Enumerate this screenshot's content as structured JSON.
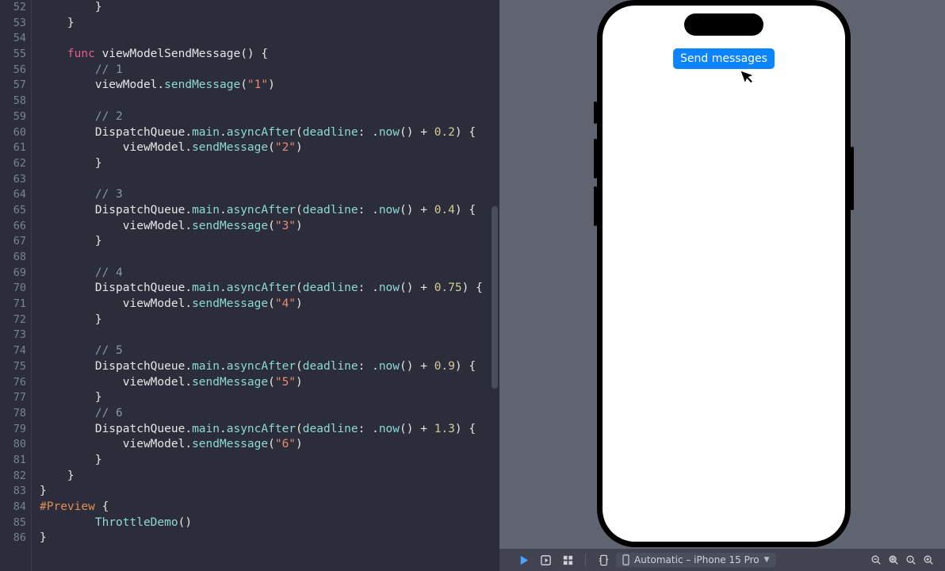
{
  "editor": {
    "line_start": 52,
    "lines": [
      {
        "n": 52,
        "indent": 4,
        "tokens": [
          {
            "t": "}",
            "c": "punct"
          }
        ]
      },
      {
        "n": 53,
        "indent": 2,
        "tokens": [
          {
            "t": "}",
            "c": "punct"
          }
        ]
      },
      {
        "n": 54,
        "indent": 0,
        "tokens": []
      },
      {
        "n": 55,
        "indent": 2,
        "tokens": [
          {
            "t": "func ",
            "c": "kw"
          },
          {
            "t": "viewModelSendMessage",
            "c": "fn"
          },
          {
            "t": "() {",
            "c": "punct"
          }
        ]
      },
      {
        "n": 56,
        "indent": 4,
        "tokens": [
          {
            "t": "// 1",
            "c": "cmt"
          }
        ]
      },
      {
        "n": 57,
        "indent": 4,
        "tokens": [
          {
            "t": "viewModel",
            "c": "fn"
          },
          {
            "t": ".",
            "c": "punct"
          },
          {
            "t": "sendMessage",
            "c": "call"
          },
          {
            "t": "(",
            "c": "punct"
          },
          {
            "t": "\"1\"",
            "c": "str"
          },
          {
            "t": ")",
            "c": "punct"
          }
        ]
      },
      {
        "n": 58,
        "indent": 0,
        "tokens": []
      },
      {
        "n": 59,
        "indent": 4,
        "tokens": [
          {
            "t": "// 2",
            "c": "cmt"
          }
        ]
      },
      {
        "n": 60,
        "indent": 4,
        "tokens": [
          {
            "t": "DispatchQueue",
            "c": "fn"
          },
          {
            "t": ".",
            "c": "punct"
          },
          {
            "t": "main",
            "c": "call"
          },
          {
            "t": ".",
            "c": "punct"
          },
          {
            "t": "asyncAfter",
            "c": "call"
          },
          {
            "t": "(",
            "c": "punct"
          },
          {
            "t": "deadline",
            "c": "param"
          },
          {
            "t": ": .",
            "c": "punct"
          },
          {
            "t": "now",
            "c": "call"
          },
          {
            "t": "() + ",
            "c": "punct"
          },
          {
            "t": "0.2",
            "c": "num"
          },
          {
            "t": ") {",
            "c": "punct"
          }
        ]
      },
      {
        "n": 61,
        "indent": 6,
        "tokens": [
          {
            "t": "viewModel",
            "c": "fn"
          },
          {
            "t": ".",
            "c": "punct"
          },
          {
            "t": "sendMessage",
            "c": "call"
          },
          {
            "t": "(",
            "c": "punct"
          },
          {
            "t": "\"2\"",
            "c": "str"
          },
          {
            "t": ")",
            "c": "punct"
          }
        ]
      },
      {
        "n": 62,
        "indent": 4,
        "tokens": [
          {
            "t": "}",
            "c": "punct"
          }
        ]
      },
      {
        "n": 63,
        "indent": 0,
        "tokens": []
      },
      {
        "n": 64,
        "indent": 4,
        "tokens": [
          {
            "t": "// 3",
            "c": "cmt"
          }
        ]
      },
      {
        "n": 65,
        "indent": 4,
        "tokens": [
          {
            "t": "DispatchQueue",
            "c": "fn"
          },
          {
            "t": ".",
            "c": "punct"
          },
          {
            "t": "main",
            "c": "call"
          },
          {
            "t": ".",
            "c": "punct"
          },
          {
            "t": "asyncAfter",
            "c": "call"
          },
          {
            "t": "(",
            "c": "punct"
          },
          {
            "t": "deadline",
            "c": "param"
          },
          {
            "t": ": .",
            "c": "punct"
          },
          {
            "t": "now",
            "c": "call"
          },
          {
            "t": "() + ",
            "c": "punct"
          },
          {
            "t": "0.4",
            "c": "num"
          },
          {
            "t": ") {",
            "c": "punct"
          }
        ]
      },
      {
        "n": 66,
        "indent": 6,
        "tokens": [
          {
            "t": "viewModel",
            "c": "fn"
          },
          {
            "t": ".",
            "c": "punct"
          },
          {
            "t": "sendMessage",
            "c": "call"
          },
          {
            "t": "(",
            "c": "punct"
          },
          {
            "t": "\"3\"",
            "c": "str"
          },
          {
            "t": ")",
            "c": "punct"
          }
        ]
      },
      {
        "n": 67,
        "indent": 4,
        "tokens": [
          {
            "t": "}",
            "c": "punct"
          }
        ]
      },
      {
        "n": 68,
        "indent": 0,
        "tokens": []
      },
      {
        "n": 69,
        "indent": 4,
        "tokens": [
          {
            "t": "// 4",
            "c": "cmt"
          }
        ]
      },
      {
        "n": 70,
        "indent": 4,
        "tokens": [
          {
            "t": "DispatchQueue",
            "c": "fn"
          },
          {
            "t": ".",
            "c": "punct"
          },
          {
            "t": "main",
            "c": "call"
          },
          {
            "t": ".",
            "c": "punct"
          },
          {
            "t": "asyncAfter",
            "c": "call"
          },
          {
            "t": "(",
            "c": "punct"
          },
          {
            "t": "deadline",
            "c": "param"
          },
          {
            "t": ": .",
            "c": "punct"
          },
          {
            "t": "now",
            "c": "call"
          },
          {
            "t": "() + ",
            "c": "punct"
          },
          {
            "t": "0.75",
            "c": "num"
          },
          {
            "t": ") {",
            "c": "punct"
          }
        ]
      },
      {
        "n": 71,
        "indent": 6,
        "tokens": [
          {
            "t": "viewModel",
            "c": "fn"
          },
          {
            "t": ".",
            "c": "punct"
          },
          {
            "t": "sendMessage",
            "c": "call"
          },
          {
            "t": "(",
            "c": "punct"
          },
          {
            "t": "\"4\"",
            "c": "str"
          },
          {
            "t": ")",
            "c": "punct"
          }
        ]
      },
      {
        "n": 72,
        "indent": 4,
        "tokens": [
          {
            "t": "}",
            "c": "punct"
          }
        ]
      },
      {
        "n": 73,
        "indent": 0,
        "tokens": []
      },
      {
        "n": 74,
        "indent": 4,
        "tokens": [
          {
            "t": "// 5",
            "c": "cmt"
          }
        ]
      },
      {
        "n": 75,
        "indent": 4,
        "tokens": [
          {
            "t": "DispatchQueue",
            "c": "fn"
          },
          {
            "t": ".",
            "c": "punct"
          },
          {
            "t": "main",
            "c": "call"
          },
          {
            "t": ".",
            "c": "punct"
          },
          {
            "t": "asyncAfter",
            "c": "call"
          },
          {
            "t": "(",
            "c": "punct"
          },
          {
            "t": "deadline",
            "c": "param"
          },
          {
            "t": ": .",
            "c": "punct"
          },
          {
            "t": "now",
            "c": "call"
          },
          {
            "t": "() + ",
            "c": "punct"
          },
          {
            "t": "0.9",
            "c": "num"
          },
          {
            "t": ") {",
            "c": "punct"
          }
        ]
      },
      {
        "n": 76,
        "indent": 6,
        "tokens": [
          {
            "t": "viewModel",
            "c": "fn"
          },
          {
            "t": ".",
            "c": "punct"
          },
          {
            "t": "sendMessage",
            "c": "call"
          },
          {
            "t": "(",
            "c": "punct"
          },
          {
            "t": "\"5\"",
            "c": "str"
          },
          {
            "t": ")",
            "c": "punct"
          }
        ]
      },
      {
        "n": 77,
        "indent": 4,
        "tokens": [
          {
            "t": "}",
            "c": "punct"
          }
        ]
      },
      {
        "n": 78,
        "indent": 4,
        "tokens": [
          {
            "t": "// 6",
            "c": "cmt"
          }
        ]
      },
      {
        "n": 79,
        "indent": 4,
        "tokens": [
          {
            "t": "DispatchQueue",
            "c": "fn"
          },
          {
            "t": ".",
            "c": "punct"
          },
          {
            "t": "main",
            "c": "call"
          },
          {
            "t": ".",
            "c": "punct"
          },
          {
            "t": "asyncAfter",
            "c": "call"
          },
          {
            "t": "(",
            "c": "punct"
          },
          {
            "t": "deadline",
            "c": "param"
          },
          {
            "t": ": .",
            "c": "punct"
          },
          {
            "t": "now",
            "c": "call"
          },
          {
            "t": "() + ",
            "c": "punct"
          },
          {
            "t": "1.3",
            "c": "num"
          },
          {
            "t": ") {",
            "c": "punct"
          }
        ]
      },
      {
        "n": 80,
        "indent": 6,
        "tokens": [
          {
            "t": "viewModel",
            "c": "fn"
          },
          {
            "t": ".",
            "c": "punct"
          },
          {
            "t": "sendMessage",
            "c": "call"
          },
          {
            "t": "(",
            "c": "punct"
          },
          {
            "t": "\"6\"",
            "c": "str"
          },
          {
            "t": ")",
            "c": "punct"
          }
        ]
      },
      {
        "n": 81,
        "indent": 4,
        "tokens": [
          {
            "t": "}",
            "c": "punct"
          }
        ]
      },
      {
        "n": 82,
        "indent": 2,
        "tokens": [
          {
            "t": "}",
            "c": "punct"
          }
        ]
      },
      {
        "n": 83,
        "indent": 0,
        "tokens": [
          {
            "t": "}",
            "c": "punct"
          }
        ]
      },
      {
        "n": 84,
        "indent": 0,
        "tokens": [
          {
            "t": "#Preview",
            "c": "dir"
          },
          {
            "t": " {",
            "c": "punct"
          }
        ]
      },
      {
        "n": 85,
        "indent": 4,
        "tokens": [
          {
            "t": "ThrottleDemo",
            "c": "call"
          },
          {
            "t": "()",
            "c": "punct"
          }
        ]
      },
      {
        "n": 86,
        "indent": 0,
        "tokens": [
          {
            "t": "}",
            "c": "punct"
          }
        ]
      }
    ]
  },
  "preview": {
    "send_button_label": "Send messages"
  },
  "toolbar": {
    "device_label": "Automatic – iPhone 15 Pro"
  }
}
